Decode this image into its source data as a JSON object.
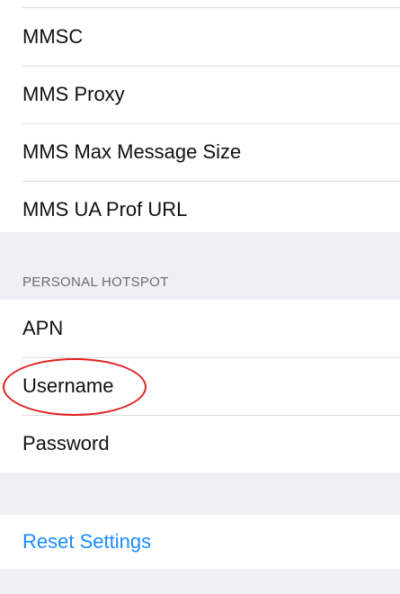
{
  "mms_group": {
    "items": [
      {
        "label": "MMSC"
      },
      {
        "label": "MMS Proxy"
      },
      {
        "label": "MMS Max Message Size"
      },
      {
        "label": "MMS UA Prof URL"
      }
    ]
  },
  "personal_hotspot": {
    "header": "PERSONAL HOTSPOT",
    "items": [
      {
        "label": "APN"
      },
      {
        "label": "Username"
      },
      {
        "label": "Password"
      }
    ]
  },
  "reset": {
    "label": "Reset Settings"
  },
  "colors": {
    "background": "#efeff4",
    "link": "#1a8cff",
    "highlight": "#e02020"
  }
}
